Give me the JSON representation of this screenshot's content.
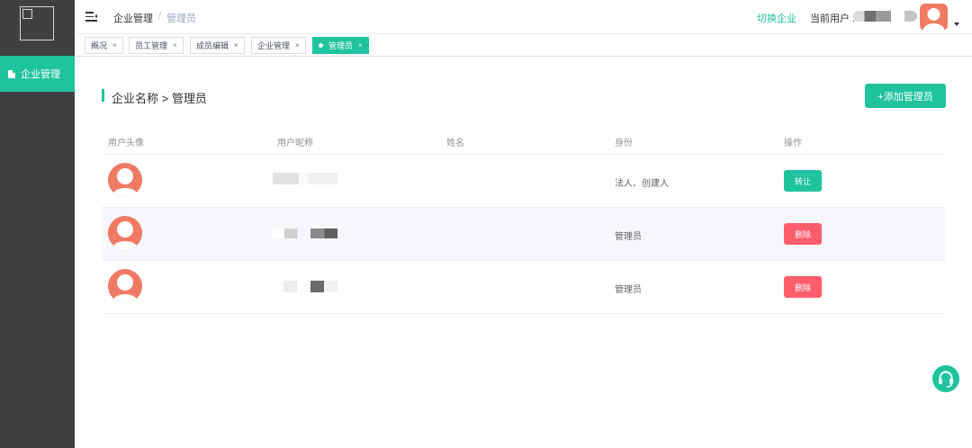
{
  "sidebar": {
    "items": [
      {
        "label": "企业管理",
        "icon": "document-icon",
        "active": true
      }
    ]
  },
  "header": {
    "breadcrumb": [
      "企业管理",
      "管理员"
    ],
    "breadcrumb_separator": "/",
    "switch_company": "切换企业",
    "current_user_label": "当前用户 :"
  },
  "tabs": [
    {
      "label": "概况",
      "active": false
    },
    {
      "label": "员工管理",
      "active": false
    },
    {
      "label": "成员编辑",
      "active": false
    },
    {
      "label": "企业管理",
      "active": false
    },
    {
      "label": "管理员",
      "active": true
    }
  ],
  "tab_close": "×",
  "page": {
    "title": "企业名称 > 管理员",
    "add_button": "+添加管理员"
  },
  "table": {
    "columns": [
      "用户头像",
      "用户昵称",
      "姓名",
      "身份",
      "操作"
    ],
    "rows": [
      {
        "role": "法人、创建人",
        "action": "转让",
        "action_color": "#1fc39d"
      },
      {
        "role": "管理员",
        "action": "删除",
        "action_color": "#fd5d6b"
      },
      {
        "role": "管理员",
        "action": "删除",
        "action_color": "#fd5d6b"
      }
    ]
  },
  "colors": {
    "accent": "#1fc39d",
    "danger": "#fd5d6b",
    "sidebar": "#404040",
    "avatar": "#f07a63"
  }
}
